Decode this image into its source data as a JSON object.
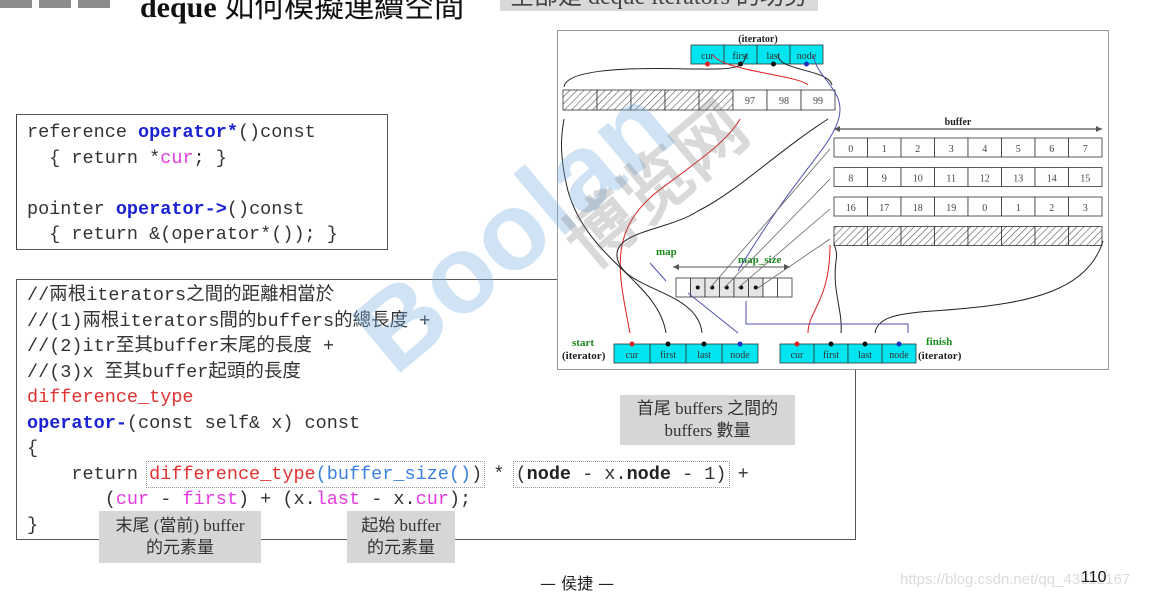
{
  "header": {
    "title_bold": "deque",
    "title_rest": " 如何模擬連續空間",
    "subtitle": "全部是 deque iterators 的功勞"
  },
  "code_box_1": {
    "lines": [
      {
        "pre": "reference ",
        "kw": "operator*",
        "post": "()const"
      },
      {
        "pre": "  { return *",
        "mag": "cur",
        "post": "; }"
      },
      {
        "blank": ""
      },
      {
        "pre": "pointer ",
        "kw": "operator->",
        "post": "()const"
      },
      {
        "pre": "  { return &(operator*()); }"
      }
    ]
  },
  "code_box_2": {
    "comment_1": "//兩根iterators之間的距離相當於",
    "comment_2": "//(1)兩根iterators間的buffers的總長度 +",
    "comment_3": "//(2)itr至其buffer末尾的長度 +",
    "comment_4": "//(3)x 至其buffer起頭的長度",
    "return_type": "difference_type",
    "op_name": "operator-",
    "op_params": "(const self& x) const",
    "open_brace": "{",
    "return_kw": "    return ",
    "diff_type_call": "difference_type",
    "paren_open": "(",
    "buffer_size_call": "buffer_size()",
    "paren_close": ")",
    "times": " * ",
    "node_expr_open": "(",
    "node_1": "node",
    "node_minus": " - x.",
    "node_2": "node",
    "node_tail": " - 1)",
    "plus": " +",
    "line2_indent": "       (",
    "cur": "cur",
    "minus": " - ",
    "first": "first",
    "mid": ") + (x.",
    "last": "last",
    "minus_x": " - x.",
    "cur2": "cur",
    "end": ");",
    "close_brace": "}"
  },
  "notes": {
    "end_buffer": [
      "末尾 (當前) buffer",
      "的元素量"
    ],
    "start_buffer": [
      "起始 buffer",
      "的元素量"
    ],
    "between_buffers": [
      "首尾 buffers 之間的",
      "buffers 數量"
    ]
  },
  "diagram": {
    "top_iterator_label": "(iterator)",
    "iterator_fields": [
      "cur",
      "first",
      "last",
      "node"
    ],
    "top_buffer_values": [
      "",
      "",
      "",
      "",
      "",
      "97",
      "98",
      "99"
    ],
    "buffer_label": "buffer",
    "buffers": [
      [
        "0",
        "1",
        "2",
        "3",
        "4",
        "5",
        "6",
        "7"
      ],
      [
        "8",
        "9",
        "10",
        "11",
        "12",
        "13",
        "14",
        "15"
      ],
      [
        "16",
        "17",
        "18",
        "19",
        "0",
        "1",
        "2",
        "3"
      ]
    ],
    "map_label": "map",
    "map_size_label": "map_size",
    "start_label": "start",
    "finish_label": "finish",
    "iterator_label": "(iterator)",
    "fill_color": "#00e5f0",
    "green_label_color": "#1a8a1a"
  },
  "footer": {
    "author": "— 侯捷 —",
    "url": "https://blog.csdn.net/qq_43812167",
    "page_number": "110"
  },
  "watermarks": {
    "brand": "Boolan",
    "cn": "博览网"
  }
}
